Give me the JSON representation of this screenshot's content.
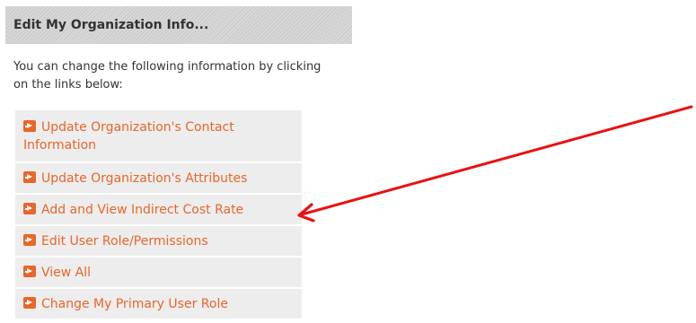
{
  "panel": {
    "title": "Edit My Organization Info...",
    "intro": "You can change the following information by clicking on the links below:"
  },
  "links": [
    {
      "label": "Update Organization's Contact Information",
      "icon": "arrow-right-icon"
    },
    {
      "label": "Update Organization's Attributes",
      "icon": "arrow-right-icon"
    },
    {
      "label": "Add and View Indirect Cost Rate",
      "icon": "arrow-right-icon"
    },
    {
      "label": "Edit User Role/Permissions",
      "icon": "arrow-right-icon"
    },
    {
      "label": "View All",
      "icon": "arrow-right-icon"
    },
    {
      "label": "Change My Primary User Role",
      "icon": "arrow-right-icon"
    }
  ],
  "colors": {
    "link": "#e8662a",
    "annotation_arrow": "#e81212",
    "header_bg": "#d0d0d0",
    "item_bg": "#ededed"
  }
}
